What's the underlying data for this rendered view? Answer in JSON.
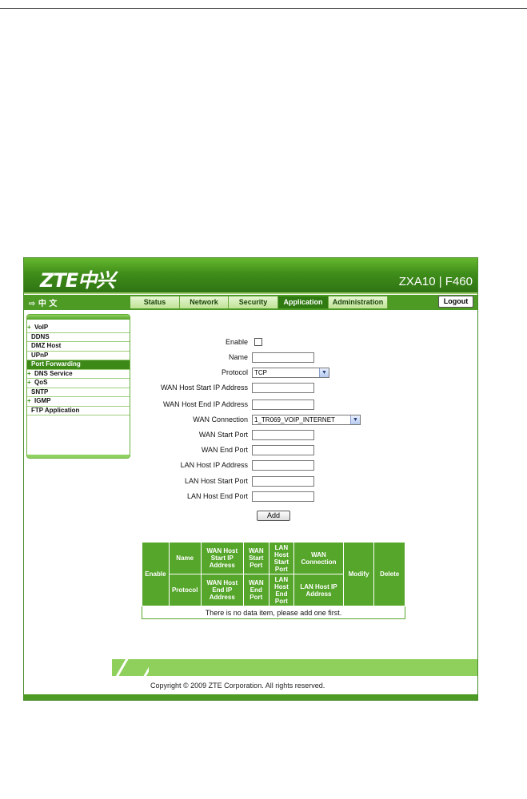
{
  "header": {
    "logo": "ZTE中兴",
    "model": "ZXA10 | F460"
  },
  "nav": {
    "lang": "⇨ 中 文",
    "tabs": [
      "Status",
      "Network",
      "Security",
      "Application",
      "Administration"
    ],
    "active_tab": "Application",
    "logout": "Logout"
  },
  "sidebar": {
    "items": [
      "VoIP",
      "DDNS",
      "DMZ Host",
      "UPnP",
      "Port Forwarding",
      "DNS Service",
      "QoS",
      "SNTP",
      "IGMP",
      "FTP Application"
    ],
    "expandable": [
      "VoIP",
      "DNS Service",
      "QoS",
      "IGMP"
    ],
    "selected": "Port Forwarding"
  },
  "form": {
    "enable_label": "Enable",
    "name_label": "Name",
    "protocol_label": "Protocol",
    "protocol_value": "TCP",
    "wan_start_ip_label": "WAN Host Start IP Address",
    "wan_end_ip_label": "WAN Host End IP Address",
    "wan_conn_label": "WAN Connection",
    "wan_conn_value": "1_TR069_VOIP_INTERNET",
    "wan_start_port_label": "WAN Start Port",
    "wan_end_port_label": "WAN End Port",
    "lan_ip_label": "LAN Host IP Address",
    "lan_start_port_label": "LAN Host Start Port",
    "lan_end_port_label": "LAN Host End Port",
    "add_button": "Add"
  },
  "table": {
    "enable": "Enable",
    "name": "Name",
    "wan_start_ip": "WAN Host Start IP Address",
    "wan_start_port": "WAN Start Port",
    "lan_start_port": "LAN Host Start Port",
    "wan_connection": "WAN Connection",
    "modify": "Modify",
    "delete": "Delete",
    "protocol": "Protocol",
    "wan_end_ip": "WAN Host End IP Address",
    "wan_end_port": "WAN End Port",
    "lan_end_port": "LAN Host End Port",
    "lan_ip": "LAN Host IP Address",
    "empty_message": "There is no data item, please add one first."
  },
  "footer": {
    "copyright": "Copyright © 2009 ZTE Corporation. All rights reserved."
  },
  "colors": {
    "brand_green": "#4d9a24",
    "active_tab": "#2f7a11",
    "table_header": "#56a62b"
  }
}
